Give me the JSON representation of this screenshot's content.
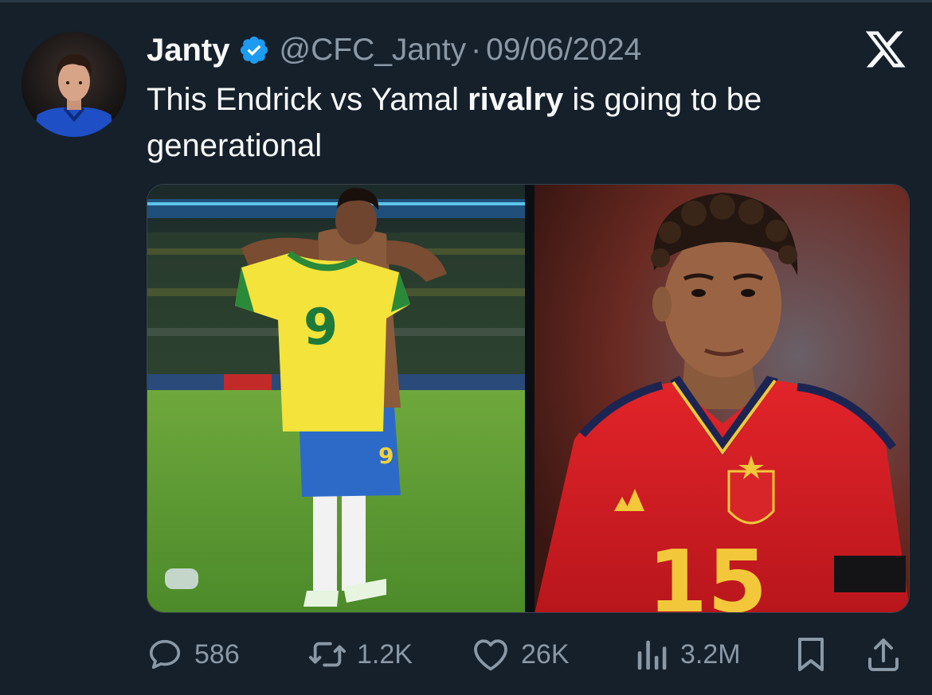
{
  "tweet": {
    "author_name": "Janty",
    "handle": "@CFC_Janty",
    "separator": "·",
    "date": "09/06/2024",
    "text_before": "This Endrick vs Yamal ",
    "text_bold": "rivalry",
    "text_after": " is going to be generational"
  },
  "media": {
    "left_image": "endrick-holding-number-9-shirt",
    "right_image": "yamal-in-red-spain-number-15-shirt",
    "left_shirt_number": "9",
    "right_shirt_number": "15"
  },
  "stats": {
    "replies": "586",
    "reposts": "1.2K",
    "likes": "26K",
    "views": "3.2M"
  },
  "icons": {
    "verified": "verified-badge-icon",
    "brand": "x-logo-icon",
    "reply": "reply-icon",
    "repost": "repost-icon",
    "like": "heart-icon",
    "views": "views-icon",
    "bookmark": "bookmark-icon",
    "share": "share-icon"
  },
  "colors": {
    "background": "#15202b",
    "text_primary": "#f7f9f9",
    "text_secondary": "#8b98a5",
    "verified_blue": "#1d9bf0"
  }
}
